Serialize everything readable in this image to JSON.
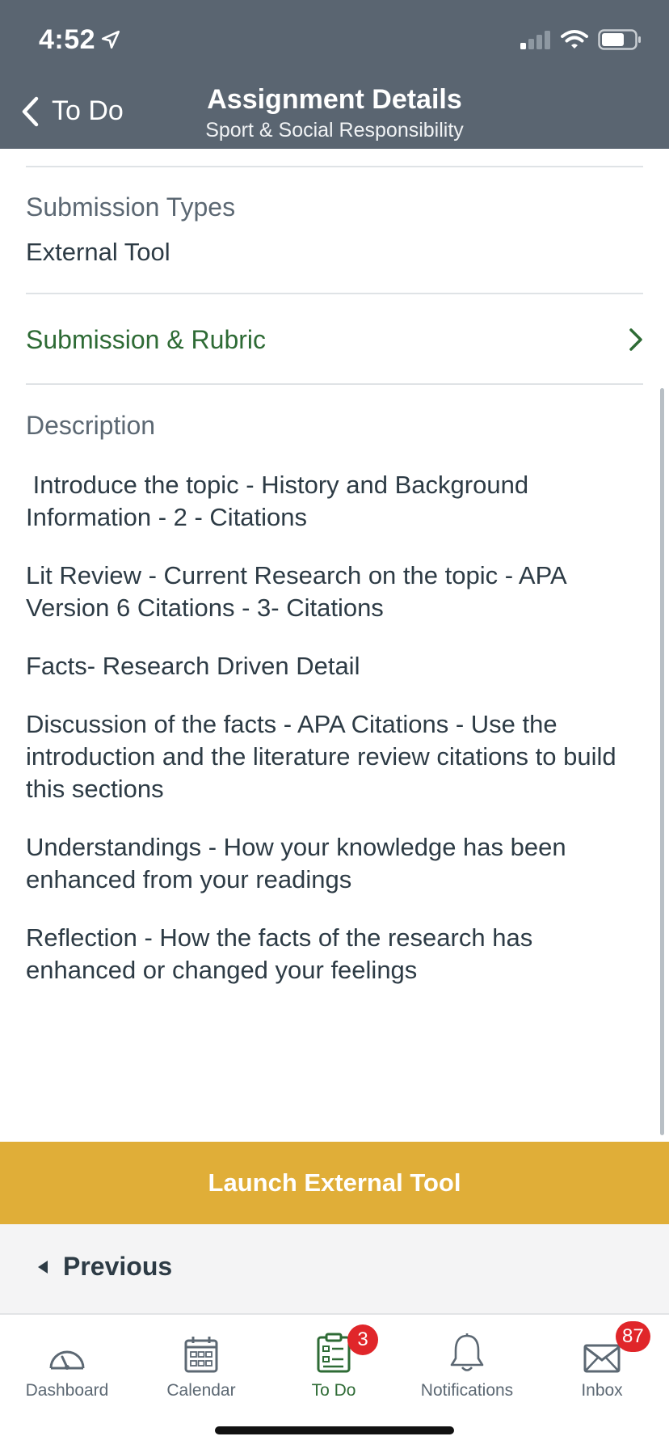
{
  "status_bar": {
    "time": "4:52"
  },
  "header": {
    "back_label": "To Do",
    "title": "Assignment Details",
    "subtitle": "Sport & Social Responsibility"
  },
  "submission_types": {
    "label": "Submission Types",
    "value": "External Tool"
  },
  "submission_rubric": {
    "label": "Submission & Rubric"
  },
  "description": {
    "label": "Description",
    "paragraphs": [
      " Introduce the topic - History and Background Information - 2 - Citations",
      "Lit Review - Current Research on the topic - APA Version 6 Citations - 3- Citations",
      "Facts- Research Driven Detail",
      "Discussion of the facts - APA Citations - Use the introduction and the literature review citations to build this sections",
      "Understandings - How your knowledge has been enhanced from your readings",
      "Reflection - How the facts of the research has enhanced or changed your feelings"
    ]
  },
  "launch_button": {
    "label": "Launch External Tool"
  },
  "previous_button": {
    "label": "Previous"
  },
  "tabbar": {
    "tabs": [
      {
        "label": "Dashboard",
        "icon": "dashboard-icon"
      },
      {
        "label": "Calendar",
        "icon": "calendar-icon"
      },
      {
        "label": "To Do",
        "icon": "todo-icon",
        "badge": "3",
        "active": true
      },
      {
        "label": "Notifications",
        "icon": "bell-icon"
      },
      {
        "label": "Inbox",
        "icon": "inbox-icon",
        "badge": "87"
      }
    ]
  },
  "colors": {
    "header_bg": "#5a6571",
    "accent_green": "#2e6b35",
    "launch_bg": "#e0ae38",
    "badge_red": "#e0262a"
  }
}
